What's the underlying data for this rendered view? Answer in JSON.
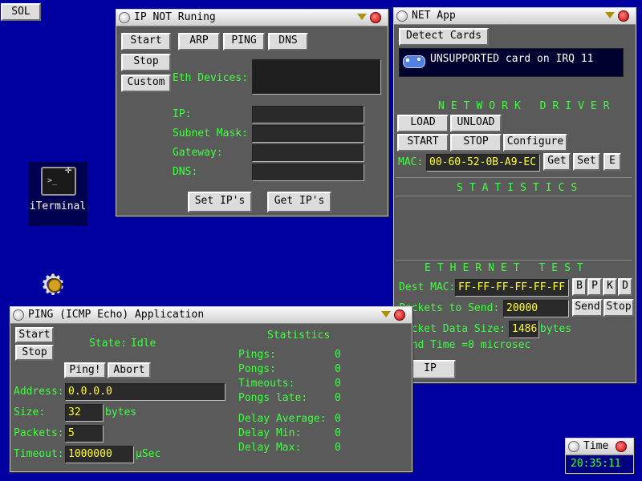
{
  "desktop": {
    "sol_button": "SOL",
    "iterminal_label": "iTerminal"
  },
  "ip_window": {
    "title": "IP NOT Runing",
    "buttons": {
      "start": "Start",
      "stop": "Stop",
      "custom": "Custom",
      "arp": "ARP",
      "ping": "PING",
      "dns": "DNS",
      "set_ips": "Set IP's",
      "get_ips": "Get IP's"
    },
    "labels": {
      "eth_devices": "Eth Devices:",
      "ip": "IP:",
      "subnet_mask": "Subnet Mask:",
      "gateway": "Gateway:",
      "dns": "DNS:"
    },
    "values": {
      "eth_devices": "",
      "ip": "",
      "subnet_mask": "",
      "gateway": "",
      "dns": ""
    }
  },
  "net_window": {
    "title": "NET App",
    "detect_cards": "Detect Cards",
    "card_message": "UNSUPPORTED card on IRQ 11",
    "network_driver_header": "NETWORK DRIVER",
    "buttons": {
      "load": "LOAD",
      "unload": "UNLOAD",
      "start": "START",
      "stop": "STOP",
      "configure": "Configure",
      "get": "Get",
      "set": "Set",
      "e": "E",
      "send": "Send",
      "stop_send": "Stop",
      "b": "B",
      "p": "P",
      "k": "K",
      "d": "D",
      "ip": "IP"
    },
    "mac_label": "MAC:",
    "mac_value": "00-60-52-0B-A9-EC",
    "statistics_header": "STATISTICS",
    "ethernet_test_header": "ETHERNET TEST",
    "dest_mac_label": "Dest MAC:",
    "dest_mac_value": "FF-FF-FF-FF-FF-FF",
    "packets_to_send_label": "Packets to Send:",
    "packets_to_send_value": "20000",
    "packet_data_size_label": "Packet Data Size:",
    "packet_data_size_value": "1486",
    "bytes_unit": "bytes",
    "send_time": "Send Time =0 microsec"
  },
  "ping_window": {
    "title": "PING (ICMP Echo) Application",
    "buttons": {
      "start": "Start",
      "stop": "Stop",
      "ping": "Ping!",
      "abort": "Abort"
    },
    "state_label": "State:",
    "state_value": "Idle",
    "statistics_header": "Statistics",
    "fields": {
      "address_label": "Address:",
      "address_value": "0.0.0.0",
      "size_label": "Size:",
      "size_value": "32",
      "size_unit": "bytes",
      "packets_label": "Packets:",
      "packets_value": "5",
      "timeout_label": "Timeout:",
      "timeout_value": "1000000",
      "timeout_unit": "µSec"
    },
    "stats": [
      {
        "label": "Pings:",
        "value": "0"
      },
      {
        "label": "Pongs:",
        "value": "0"
      },
      {
        "label": "Timeouts:",
        "value": "0"
      },
      {
        "label": "Pongs late:",
        "value": "0"
      },
      {
        "label": "Delay Average:",
        "value": "0"
      },
      {
        "label": "Delay Min:",
        "value": "0"
      },
      {
        "label": "Delay Max:",
        "value": "0"
      }
    ]
  },
  "time_window": {
    "title": "Time",
    "value": "20:35:11"
  }
}
